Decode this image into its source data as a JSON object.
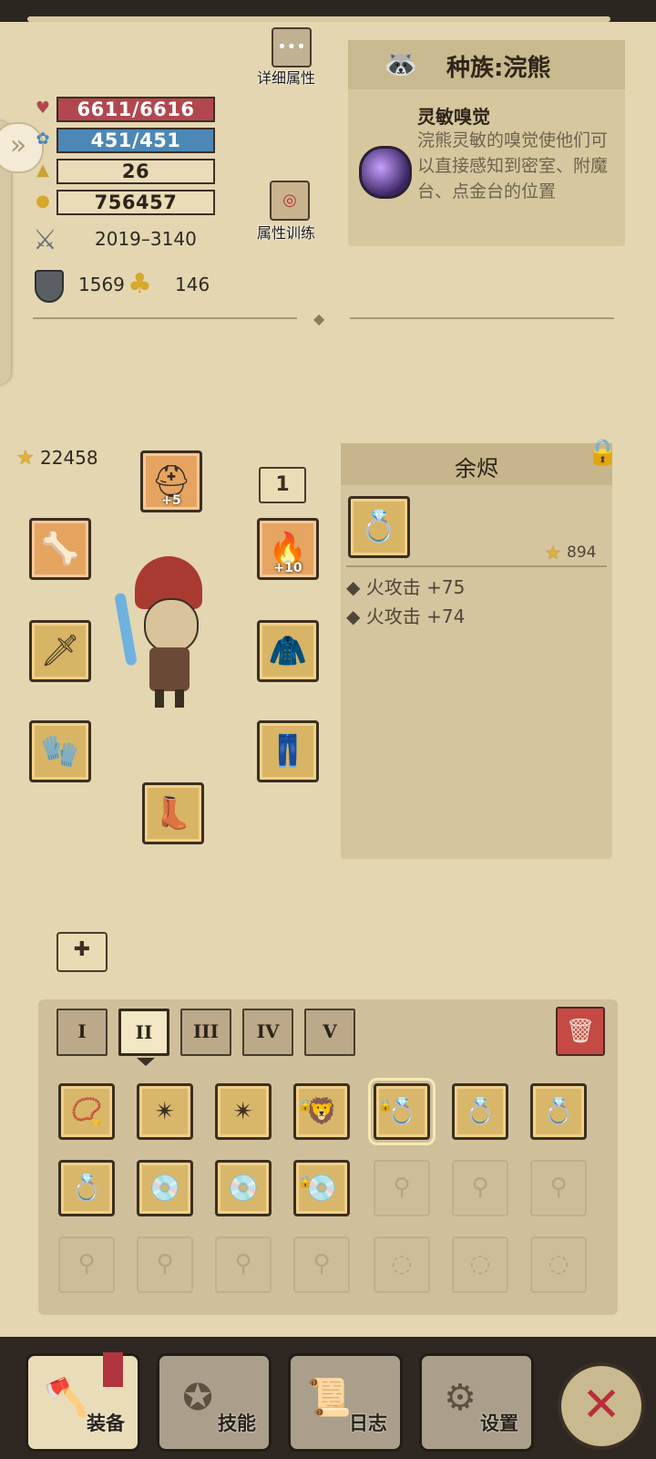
{
  "stats": {
    "hp": "6611/6616",
    "mp": "451/451",
    "level": "26",
    "gold": "756457",
    "attack": "2019–3140",
    "armor": "1569",
    "luck": "146"
  },
  "buttons": {
    "detail_attrs": "详细属性",
    "attr_training": "属性训练"
  },
  "race": {
    "title": "种族:浣熊",
    "trait_name": "灵敏嗅觉",
    "trait_desc": "浣熊灵敏的嗅觉使他们可以直接感知到密室、附魔台、点金台的位置"
  },
  "equipment": {
    "gear_score": "22458",
    "helmet_enh": "+5",
    "page_indicator": "1",
    "amulet_enh": "+10"
  },
  "item": {
    "name": "余烬",
    "score": "894",
    "attrs": [
      "火攻击 +75",
      "火攻击 +74"
    ]
  },
  "tiers": [
    "I",
    "II",
    "III",
    "IV",
    "V"
  ],
  "active_tier": "II",
  "nav": {
    "equip": "装备",
    "skills": "技能",
    "log": "日志",
    "settings": "设置"
  },
  "icons": {
    "hp": "heart-icon",
    "mp": "mana-flower-icon",
    "level": "triangle-icon",
    "gold": "gold-coins-icon"
  },
  "colors": {
    "hp_bar": "#b2474f",
    "mp_bar": "#4d87b5",
    "close": "#b82f3b"
  }
}
